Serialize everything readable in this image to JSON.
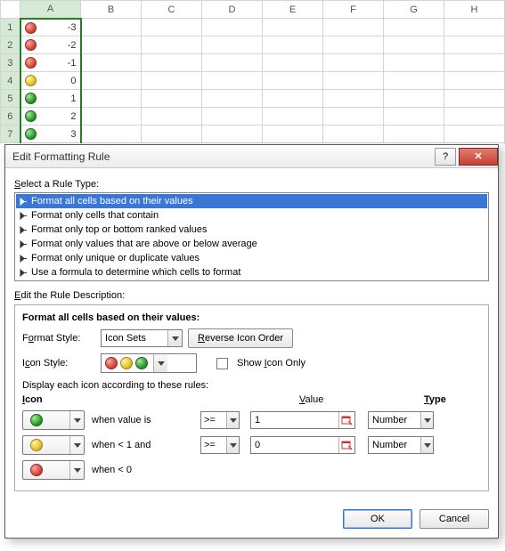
{
  "sheet": {
    "columns": [
      "A",
      "B",
      "C",
      "D",
      "E",
      "F",
      "G",
      "H"
    ],
    "rows": [
      {
        "n": 1,
        "icon": "red",
        "value": -3
      },
      {
        "n": 2,
        "icon": "red",
        "value": -2
      },
      {
        "n": 3,
        "icon": "red",
        "value": -1
      },
      {
        "n": 4,
        "icon": "yellow",
        "value": 0
      },
      {
        "n": 5,
        "icon": "green",
        "value": 1
      },
      {
        "n": 6,
        "icon": "green",
        "value": 2
      },
      {
        "n": 7,
        "icon": "green",
        "value": 3
      }
    ],
    "selected_column": "A"
  },
  "dialog": {
    "title": "Edit Formatting Rule",
    "help": "?",
    "close": "✕",
    "select_rule_label": "Select a Rule Type:",
    "rule_types": [
      "Format all cells based on their values",
      "Format only cells that contain",
      "Format only top or bottom ranked values",
      "Format only values that are above or below average",
      "Format only unique or duplicate values",
      "Use a formula to determine which cells to format"
    ],
    "selected_rule_index": 0,
    "edit_desc_label": "Edit the Rule Description:",
    "desc_heading": "Format all cells based on their values:",
    "format_style_label": "Format Style:",
    "format_style_value": "Icon Sets",
    "reverse_btn": "Reverse Icon Order",
    "icon_style_label": "Icon Style:",
    "show_icon_only_label": "Show Icon Only",
    "display_rules_label": "Display each icon according to these rules:",
    "col_icon": "Icon",
    "col_value": "Value",
    "col_type": "Type",
    "rules": [
      {
        "icon": "green",
        "text": "when value is",
        "op": ">=",
        "value": "1",
        "type": "Number"
      },
      {
        "icon": "yellow",
        "text": "when < 1 and",
        "op": ">=",
        "value": "0",
        "type": "Number"
      },
      {
        "icon": "red",
        "text": "when < 0",
        "op": "",
        "value": "",
        "type": ""
      }
    ],
    "ok": "OK",
    "cancel": "Cancel"
  }
}
